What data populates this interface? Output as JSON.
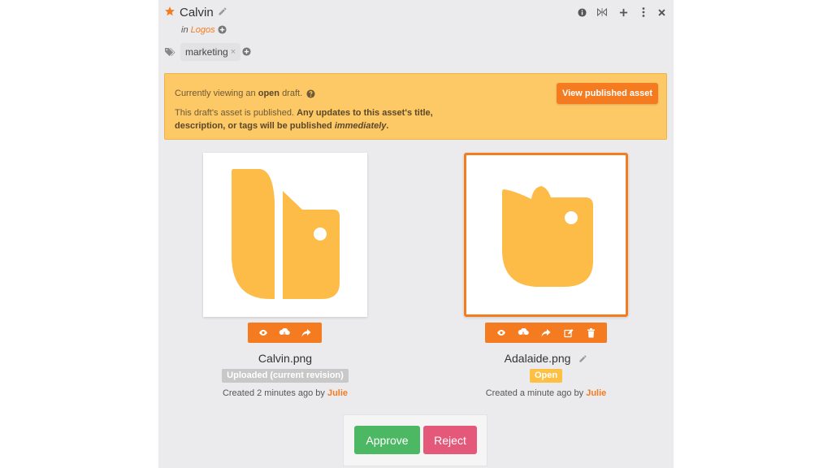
{
  "header": {
    "title": "Calvin",
    "in_prefix": "in",
    "collection": "Logos",
    "icons": [
      "info-icon",
      "compare-icon",
      "plus-icon",
      "more-icon",
      "close-icon"
    ]
  },
  "tags": {
    "items": [
      {
        "label": "marketing",
        "remove": "×"
      }
    ]
  },
  "banner": {
    "line1_prefix": "Currently viewing an",
    "line1_state": "open",
    "line1_suffix": "draft.",
    "line2_prefix": "This draft's asset is published.",
    "line2_bold": "Any updates to this asset's title, description, or tags will be published",
    "line2_em": "immediately",
    "line2_end": ".",
    "button_label": "View published asset"
  },
  "revisions": [
    {
      "filename": "Calvin.png",
      "status": "Uploaded (current revision)",
      "created_prefix": "Created 2 minutes ago by",
      "user": "Julie",
      "tools": [
        "eye-icon",
        "download-cloud-icon",
        "share-icon"
      ]
    },
    {
      "filename": "Adalaide.png",
      "status": "Open",
      "created_prefix": "Created a minute ago by",
      "user": "Julie",
      "tools": [
        "eye-icon",
        "download-cloud-icon",
        "share-icon",
        "edit-icon",
        "trash-icon"
      ]
    }
  ],
  "actions": {
    "approve": "Approve",
    "reject": "Reject"
  },
  "colors": {
    "accent": "#f47b20",
    "logo": "#fdbb48",
    "banner": "#fdc866",
    "approve": "#4cb863",
    "reject": "#e4587a"
  }
}
